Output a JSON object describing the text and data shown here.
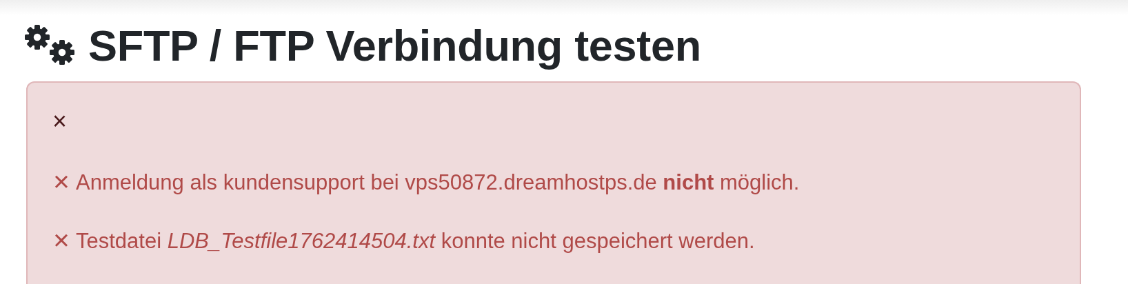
{
  "heading": {
    "title": "SFTP / FTP Verbindung testen"
  },
  "alert": {
    "close": "×",
    "messages": [
      {
        "icon": "✕",
        "text": "Anmeldung als kundensupport bei vps50872.dreamhostps.de **nicht** möglich."
      },
      {
        "icon": "✕",
        "text": "Testdatei *LDB_Testfile1762414504.txt* konnte nicht gespeichert werden."
      }
    ]
  }
}
